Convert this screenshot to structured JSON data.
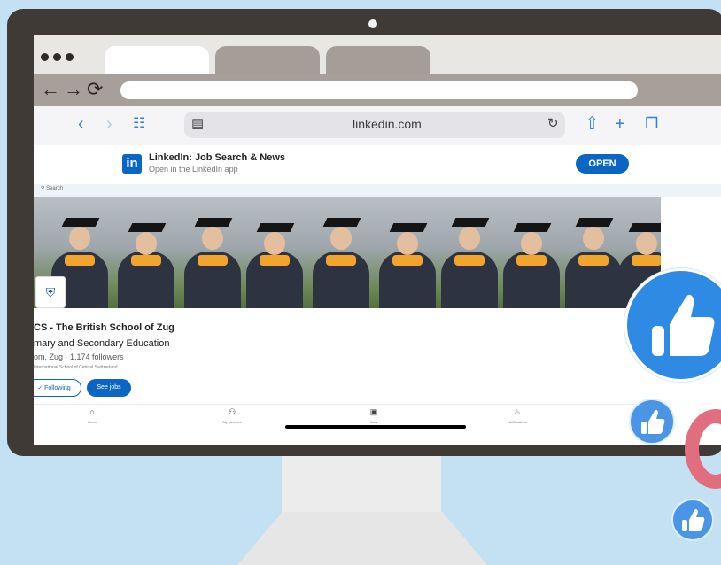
{
  "browser": {
    "window_dots": [
      "dot",
      "dot",
      "dot"
    ],
    "nav_icons": {
      "back": "back-arrow-icon",
      "forward": "forward-arrow-icon",
      "reload": "reload-icon"
    },
    "url_value": ""
  },
  "safari": {
    "url": "linkedin.com",
    "icons": [
      "back-chevron-icon",
      "forward-chevron-icon",
      "book-icon",
      "site-settings-icon",
      "reload-icon",
      "share-icon",
      "plus-icon",
      "tabs-icon"
    ]
  },
  "app_banner": {
    "title": "LinkedIn: Job Search & News",
    "subtitle": "Open in the LinkedIn app",
    "logo_text": "in",
    "open_label": "OPEN"
  },
  "search": {
    "label": "Search"
  },
  "profile": {
    "name": "CS - The British School of Zug",
    "industry": "mary and Secondary Education",
    "location": "om, Zug",
    "followers": "1,174 followers",
    "tagline": "International School of Central Switzerland",
    "follow_label": "Following",
    "follow_icon": "check-icon",
    "jobs_label": "See jobs"
  },
  "bottom_nav": [
    {
      "icon": "home-icon",
      "label": "Home"
    },
    {
      "icon": "network-icon",
      "label": "My Network"
    },
    {
      "icon": "jobs-icon",
      "label": "Jobs"
    },
    {
      "icon": "notifications-icon",
      "label": "Notifications"
    }
  ],
  "colors": {
    "background": "#c3e1f3",
    "monitor": "#403a37",
    "linkedin_blue": "#0a66c2",
    "like_blue": "#2f8ae3",
    "heart": "#e06e7f"
  }
}
